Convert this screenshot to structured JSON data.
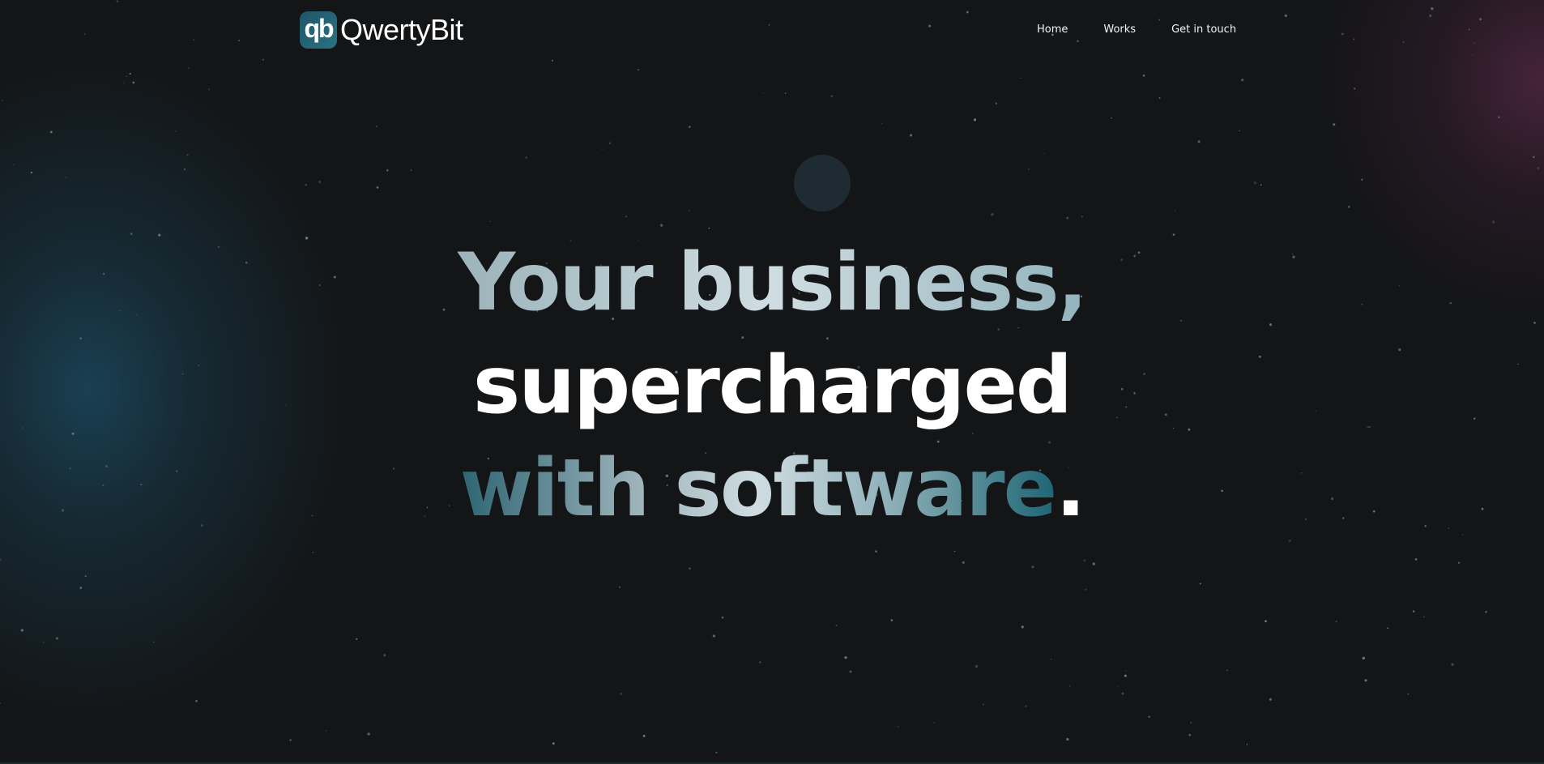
{
  "header": {
    "logo_mark": "qb",
    "logo_word": "QwertyBit",
    "nav": [
      {
        "label": "Home"
      },
      {
        "label": "Works"
      },
      {
        "label": "Get in touch"
      }
    ]
  },
  "hero": {
    "line1": "Your business,",
    "line2": "supercharged",
    "line3_main": "with software",
    "line3_end": "."
  },
  "colors": {
    "background": "#131517",
    "accent_teal": "#2a7285",
    "glow_left": "#1c4e66",
    "glow_right": "#56284a",
    "text_white": "#ffffff"
  }
}
